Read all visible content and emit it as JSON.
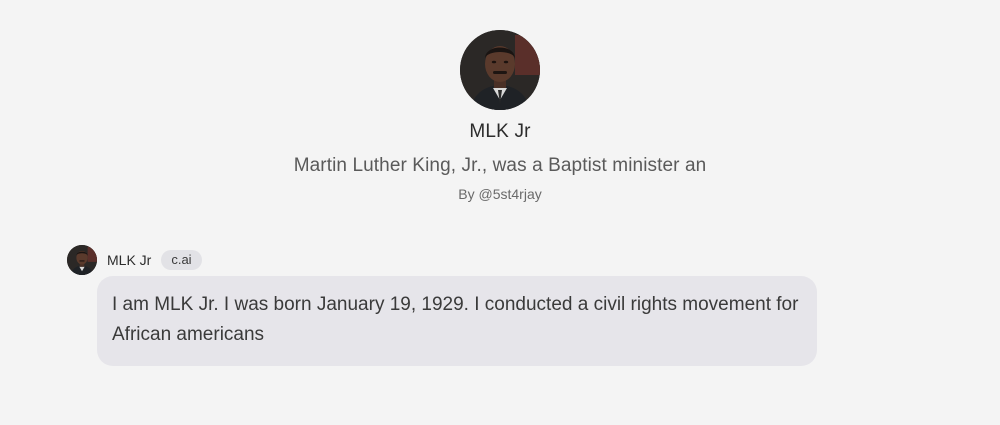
{
  "character": {
    "name": "MLK Jr",
    "description": "Martin Luther King, Jr., was a Baptist minister an",
    "author": "By @5st4rjay",
    "avatar_icon": "portrait-avatar"
  },
  "message": {
    "sender": "MLK Jr",
    "badge": "c.ai",
    "text": "I am MLK Jr. I was born January 19, 1929. I conducted a civil rights movement for African americans"
  },
  "colors": {
    "background": "#f4f4f4",
    "bubble": "#e6e5ea",
    "badge": "#e2e2e6"
  }
}
